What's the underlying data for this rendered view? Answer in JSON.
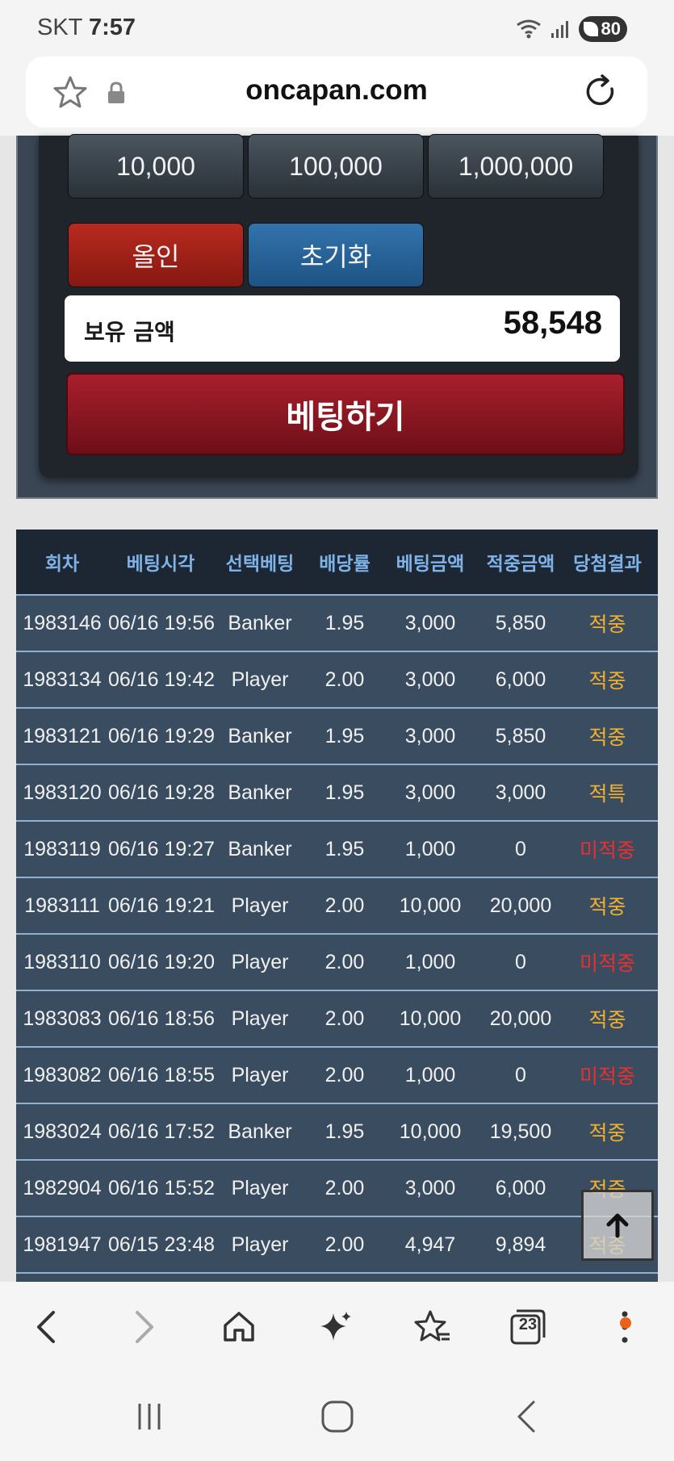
{
  "status_bar": {
    "carrier": "SKT",
    "time": "7:57",
    "battery": "80"
  },
  "browser": {
    "url": "oncapan.com",
    "tab_count": "23"
  },
  "betting": {
    "chips": [
      "10,000",
      "100,000",
      "1,000,000"
    ],
    "allin_label": "올인",
    "reset_label": "초기화",
    "balance_label": "보유 금액",
    "balance_value": "58,548",
    "bet_button_label": "베팅하기"
  },
  "history": {
    "headers": [
      "회차",
      "베팅시각",
      "선택베팅",
      "배당률",
      "베팅금액",
      "적중금액",
      "당첨결과"
    ],
    "rows": [
      [
        "1983146",
        "06/16 19:56",
        "Banker",
        "1.95",
        "3,000",
        "5,850",
        "적중"
      ],
      [
        "1983134",
        "06/16 19:42",
        "Player",
        "2.00",
        "3,000",
        "6,000",
        "적중"
      ],
      [
        "1983121",
        "06/16 19:29",
        "Banker",
        "1.95",
        "3,000",
        "5,850",
        "적중"
      ],
      [
        "1983120",
        "06/16 19:28",
        "Banker",
        "1.95",
        "3,000",
        "3,000",
        "적특"
      ],
      [
        "1983119",
        "06/16 19:27",
        "Banker",
        "1.95",
        "1,000",
        "0",
        "미적중"
      ],
      [
        "1983111",
        "06/16 19:21",
        "Player",
        "2.00",
        "10,000",
        "20,000",
        "적중"
      ],
      [
        "1983110",
        "06/16 19:20",
        "Player",
        "2.00",
        "1,000",
        "0",
        "미적중"
      ],
      [
        "1983083",
        "06/16 18:56",
        "Player",
        "2.00",
        "10,000",
        "20,000",
        "적중"
      ],
      [
        "1983082",
        "06/16 18:55",
        "Player",
        "2.00",
        "1,000",
        "0",
        "미적중"
      ],
      [
        "1983024",
        "06/16 17:52",
        "Banker",
        "1.95",
        "10,000",
        "19,500",
        "적중"
      ],
      [
        "1982904",
        "06/16 15:52",
        "Player",
        "2.00",
        "3,000",
        "6,000",
        "적중"
      ],
      [
        "1981947",
        "06/15 23:48",
        "Player",
        "2.00",
        "4,947",
        "9,894",
        "적중"
      ]
    ],
    "result_colors": {
      "win": "#f0b030",
      "lose": "#e83030"
    }
  }
}
